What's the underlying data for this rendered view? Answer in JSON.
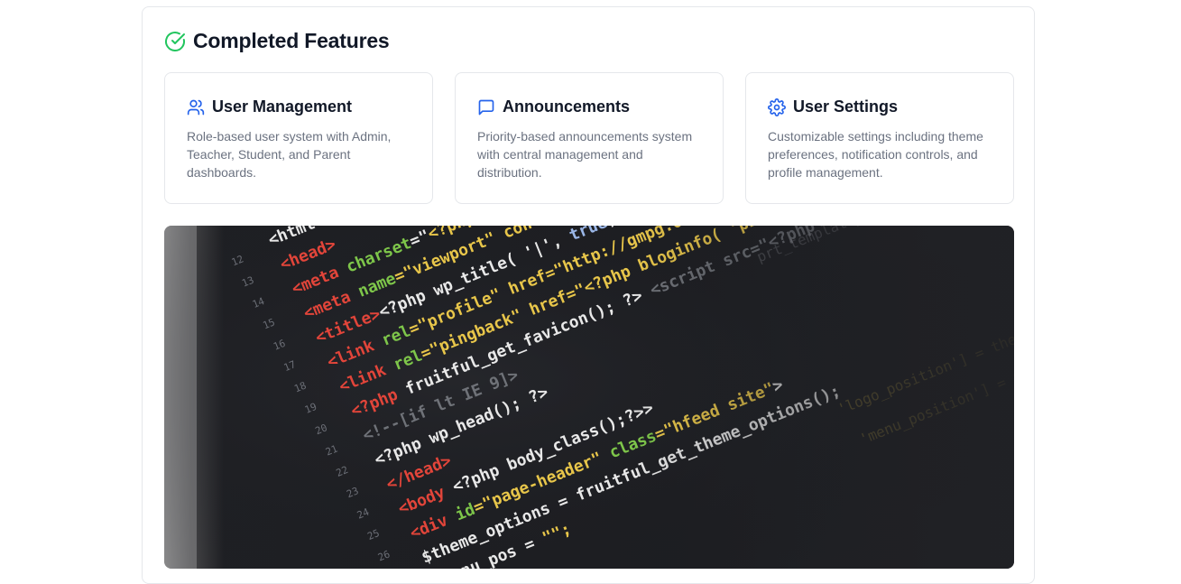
{
  "section": {
    "title": "Completed Features",
    "title_icon": "check-circle-icon"
  },
  "features": [
    {
      "icon": "users-icon",
      "title": "User Management",
      "description": "Role-based user system with Admin, Teacher, Student, and Parent dashboards."
    },
    {
      "icon": "message-square-icon",
      "title": "Announcements",
      "description": "Priority-based announcements system with central management and distribution."
    },
    {
      "icon": "gear-icon",
      "title": "User Settings",
      "description": "Customizable settings including theme preferences, notification controls, and profile management."
    }
  ],
  "image": {
    "subject": "photo of PHP source code on a dark editor screen"
  },
  "colors": {
    "success": "#22c55e",
    "accent": "#2563eb",
    "title": "#111827",
    "muted": "#6b7280",
    "border": "#e5e7eb"
  }
}
